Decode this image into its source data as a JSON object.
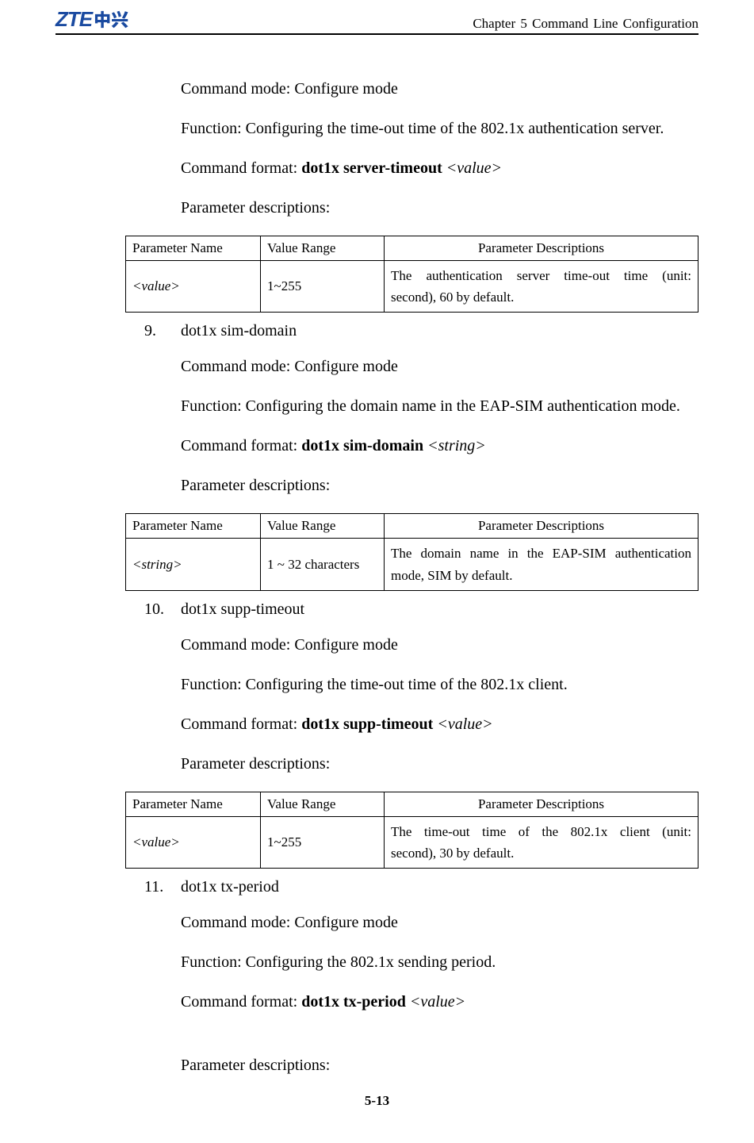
{
  "header": {
    "logo_en": "ZTE",
    "logo_ch": "中兴",
    "chapter": "Chapter 5 Command Line Configuration"
  },
  "sec8": {
    "mode": "Command mode: Configure mode",
    "func": "Function: Configuring the time-out time of the 802.1x authentication server.",
    "fmt_label": "Command format: ",
    "fmt_bold": "dot1x server-timeout ",
    "fmt_arg": "<value>",
    "pdesc": "Parameter descriptions:",
    "th1": "Parameter Name",
    "th2": "Value Range",
    "th3": "Parameter Descriptions",
    "r_name": "<value>",
    "r_range": "1~255",
    "r_desc1": "The authentication server time-out time (unit:",
    "r_desc2": "second), 60 by default."
  },
  "sec9": {
    "num": "9.",
    "title": "dot1x sim-domain",
    "mode": "Command mode: Configure mode",
    "func": "Function: Configuring the domain name in the EAP-SIM authentication mode.",
    "fmt_label": "Command format: ",
    "fmt_bold": "dot1x sim-domain ",
    "fmt_arg": "<string>",
    "pdesc": "Parameter descriptions:",
    "th1": "Parameter Name",
    "th2": "Value Range",
    "th3": "Parameter Descriptions",
    "r_name": "<string>",
    "r_range": "1 ~ 32 characters",
    "r_desc1": "The domain name in the EAP-SIM authentication",
    "r_desc2": "mode, SIM by default."
  },
  "sec10": {
    "num": "10.",
    "title": "dot1x supp-timeout",
    "mode": "Command mode: Configure mode",
    "func": "Function: Configuring the time-out time of the 802.1x client.",
    "fmt_label": "Command format: ",
    "fmt_bold": "dot1x supp-timeout ",
    "fmt_arg": "<value>",
    "pdesc": "Parameter descriptions:",
    "th1": "Parameter Name",
    "th2": "Value Range",
    "th3": "Parameter Descriptions",
    "r_name": "<value>",
    "r_range": "1~255",
    "r_desc1": "The time-out time of the 802.1x client (unit:",
    "r_desc2": "second), 30 by default."
  },
  "sec11": {
    "num": "11.",
    "title": "dot1x tx-period",
    "mode": "Command mode: Configure mode",
    "func": "Function: Configuring the 802.1x sending period.",
    "fmt_label": "Command format: ",
    "fmt_bold": "dot1x tx-period ",
    "fmt_arg": "<value>",
    "pdesc": "Parameter descriptions:"
  },
  "pagenum": "5-13"
}
